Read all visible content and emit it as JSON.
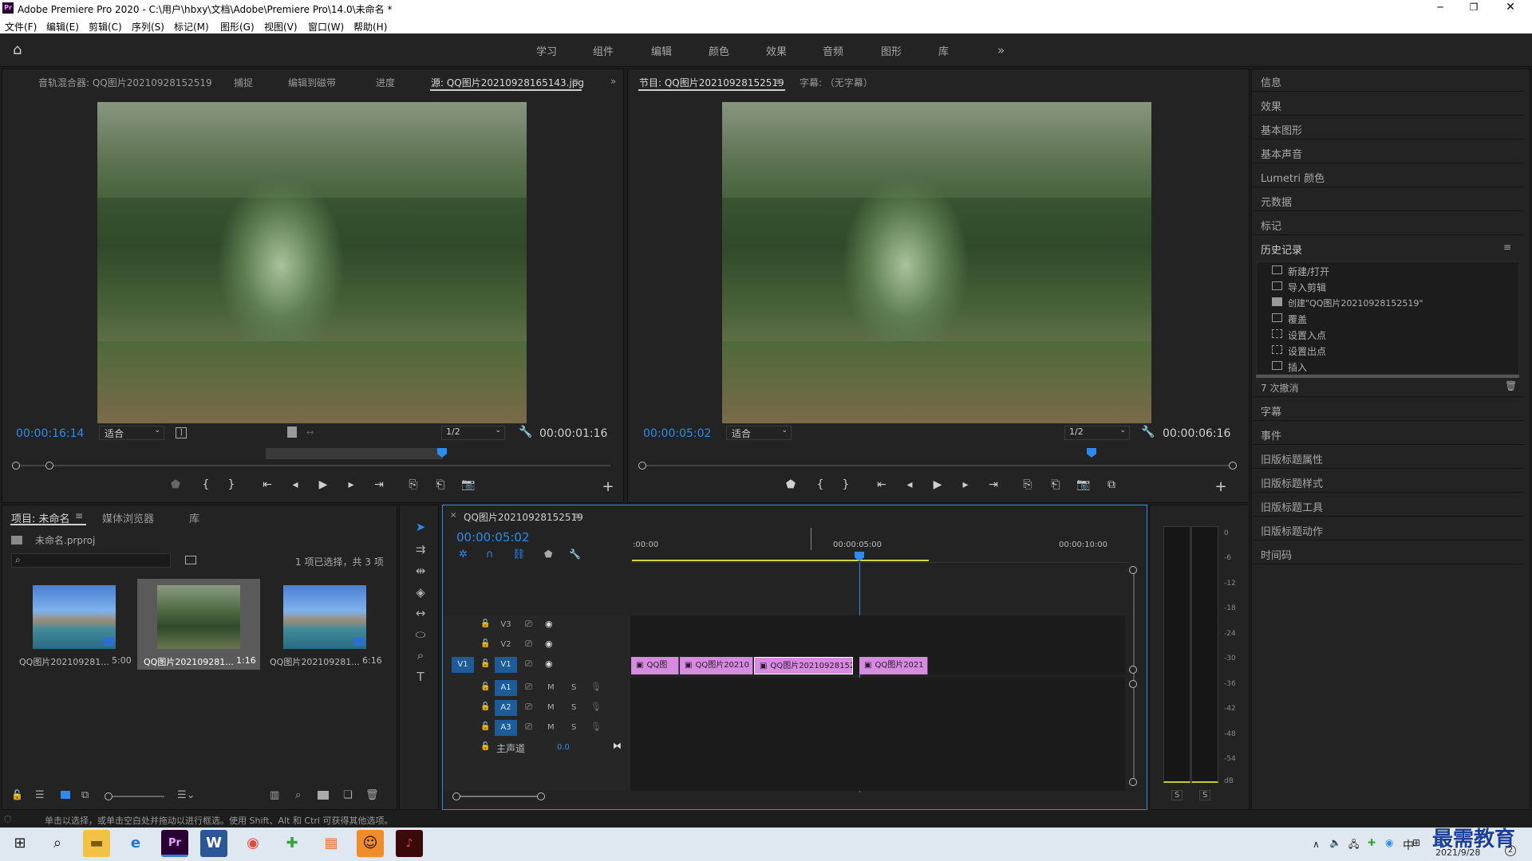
{
  "app": {
    "title": "Adobe Premiere Pro 2020 - C:\\用户\\hbxy\\文档\\Adobe\\Premiere Pro\\14.0\\未命名 *",
    "window_controls": [
      "minimize-icon",
      "restore-icon",
      "close-icon"
    ]
  },
  "menu": [
    "文件(F)",
    "编辑(E)",
    "剪辑(C)",
    "序列(S)",
    "标记(M)",
    "图形(G)",
    "视图(V)",
    "窗口(W)",
    "帮助(H)"
  ],
  "workspaces": [
    "学习",
    "组件",
    "编辑",
    "颜色",
    "效果",
    "音频",
    "图形",
    "库"
  ],
  "source_panel": {
    "tabs": [
      "音轨混合器: QQ图片20210928152519",
      "捕捉",
      "编辑到磁带",
      "进度",
      "源: QQ图片20210928165143.jpg"
    ],
    "timecode_left": "00:00:16:14",
    "timecode_right": "00:00:01:16",
    "zoom": "适合",
    "resolution": "1/2"
  },
  "program_panel": {
    "tabs": [
      "节目: QQ图片20210928152519",
      "字幕: （无字幕）"
    ],
    "timecode_left": "00:00:05:02",
    "timecode_right": "00:00:06:16",
    "zoom": "适合",
    "resolution": "1/2"
  },
  "right_panel": {
    "items_top": [
      "信息",
      "效果",
      "基本图形",
      "基本声音",
      "Lumetri 颜色",
      "元数据",
      "标记"
    ],
    "history_title": "历史记录",
    "history": [
      "新建/打开",
      "导入剪辑",
      "创建\"QQ图片20210928152519\"",
      "覆盖",
      "设置入点",
      "设置出点",
      "插入"
    ],
    "undo_count": "7 次撤消",
    "items_bottom": [
      "字幕",
      "事件",
      "旧版标题属性",
      "旧版标题样式",
      "旧版标题工具",
      "旧版标题动作",
      "时间码"
    ]
  },
  "project_panel": {
    "tabs": [
      "项目: 未命名",
      "媒体浏览器",
      "库"
    ],
    "file": "未命名.prproj",
    "selection": "1 项已选择，共 3 项",
    "items": [
      {
        "name": "QQ图片202109281...",
        "duration": "5:00"
      },
      {
        "name": "QQ图片202109281...",
        "duration": "1:16"
      },
      {
        "name": "QQ图片202109281...",
        "duration": "6:16"
      }
    ]
  },
  "timeline": {
    "sequence": "QQ图片20210928152519",
    "timecode": "00:00:05:02",
    "ruler": [
      ":00:00",
      "00:00:05:00",
      "00:00:10:00"
    ],
    "video_tracks": [
      "V3",
      "V2",
      "V1"
    ],
    "audio_tracks": [
      "A1",
      "A2",
      "A3"
    ],
    "master": "主声道",
    "master_value": "0.0",
    "clips": [
      "QQ图",
      "QQ图片20210",
      "QQ图片20210928152",
      "QQ图片2021"
    ],
    "v1_source": "V1"
  },
  "meter": {
    "scale": [
      "0",
      "-6",
      "-12",
      "-18",
      "-24",
      "-30",
      "-36",
      "-42",
      "-48",
      "-54",
      "dB"
    ],
    "solo": [
      "S",
      "S"
    ]
  },
  "status_bar": "单击以选择，或单击空白处并拖动以进行框选。使用 Shift、Alt 和 Ctrl 可获得其他选项。",
  "taskbar": {
    "ime": "中",
    "date": "2021/9/28",
    "watermark": "最需教育",
    "tray_number": "2"
  },
  "colors": {
    "accent": "#2d8ceb",
    "clip": "#d78be0",
    "panel": "#232323",
    "playhead": "#2d8ceb"
  }
}
